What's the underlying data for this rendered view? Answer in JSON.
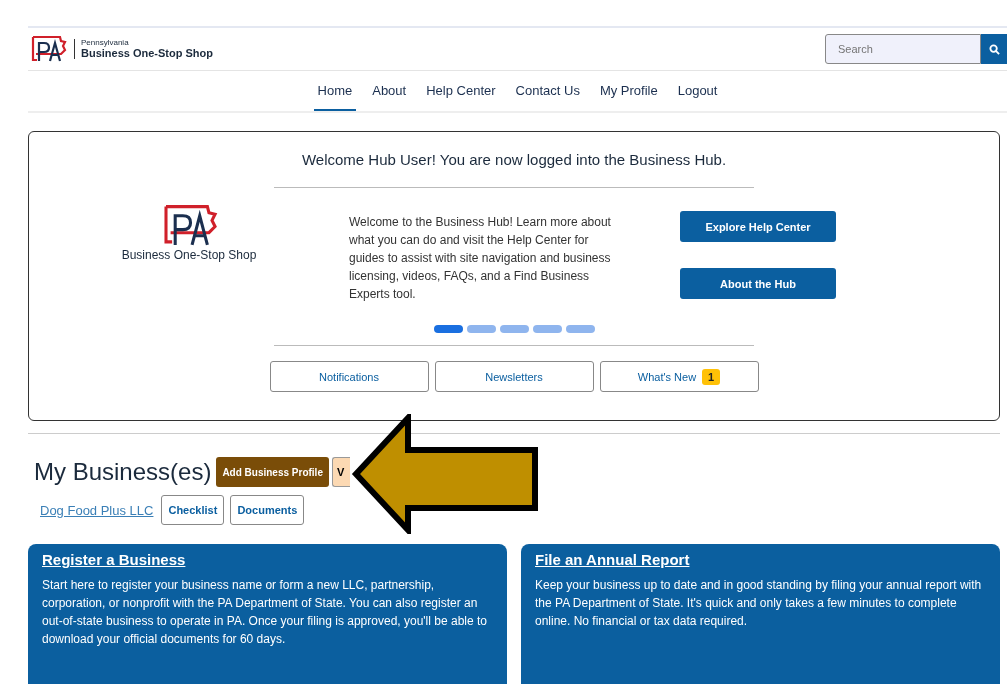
{
  "header": {
    "logo_small": "Pennsylvania",
    "logo_title": "Business One-Stop Shop",
    "search": {
      "placeholder": "Search"
    }
  },
  "nav": [
    {
      "label": "Home",
      "selected": true
    },
    {
      "label": "About",
      "selected": false
    },
    {
      "label": "Help Center",
      "selected": false
    },
    {
      "label": "Contact Us",
      "selected": false
    },
    {
      "label": "My Profile",
      "selected": false
    },
    {
      "label": "Logout",
      "selected": false
    }
  ],
  "hero": {
    "title": "Welcome Hub User! You are now logged into the Business Hub.",
    "logo_caption": "Business One-Stop Shop",
    "text": "Welcome to the Business Hub! Learn more about what you can do and visit the Help Center for guides to assist with site navigation and business licensing, videos, FAQs, and a Find Business Experts tool.",
    "buttons": [
      "Explore Help Center",
      "About the Hub"
    ],
    "dots": [
      {
        "selected": true
      },
      {
        "selected": false
      },
      {
        "selected": false
      },
      {
        "selected": false
      },
      {
        "selected": false
      }
    ],
    "tabs": [
      {
        "label": "Notifications"
      },
      {
        "label": "Newsletters"
      },
      {
        "label": "What's New",
        "badge": "1"
      }
    ]
  },
  "businesses": {
    "title": "My Business(es)",
    "add_button": "Add Business Profile",
    "second_button": "V",
    "items": [
      {
        "name": "Dog Food Plus LLC",
        "buttons": [
          "Checklist",
          "Documents"
        ]
      }
    ]
  },
  "cards": [
    {
      "title": "Register a Business",
      "text": "Start here to register your business name or form a new LLC, partnership, corporation, or nonprofit with the PA Department of State. You can also register an out-of-state business to operate in PA. Once your filing is approved, you'll be able to download your official documents for 60 days."
    },
    {
      "title": "File an Annual Report",
      "text": "Keep your business up to date and in good standing by filing your annual report with the PA Department of State. It's quick and only takes a few minutes to complete online. No financial or tax data required."
    }
  ]
}
